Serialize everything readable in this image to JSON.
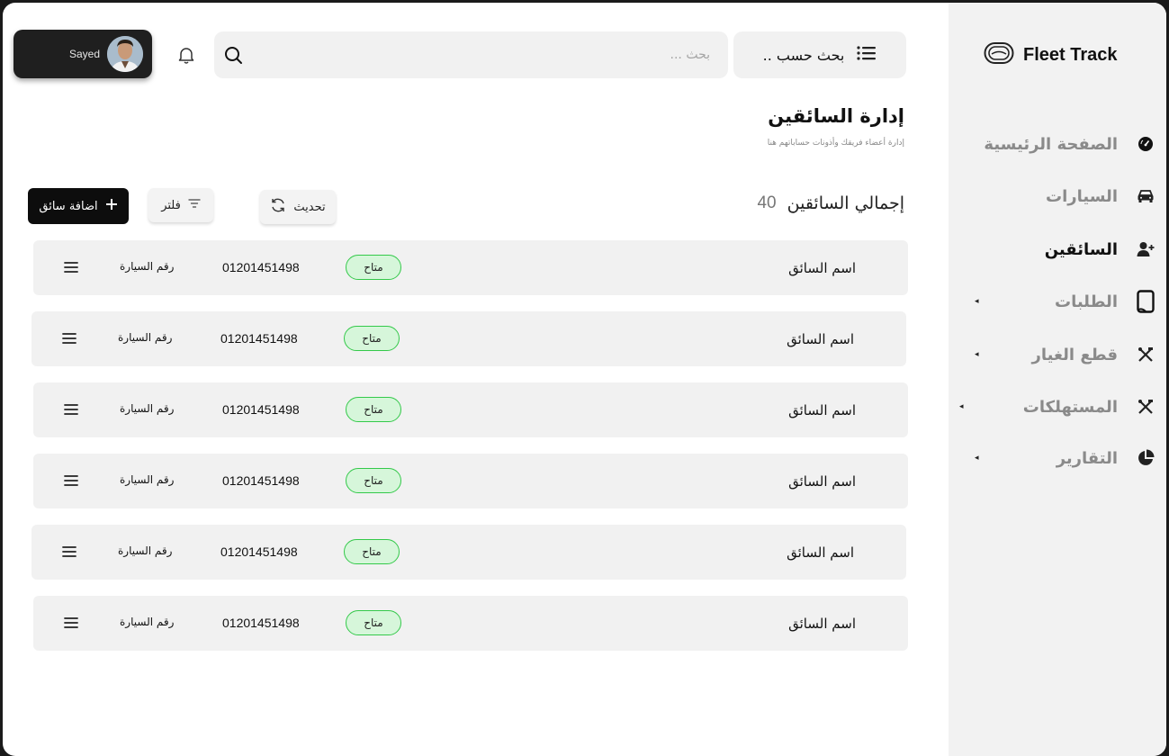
{
  "app": {
    "name": "Fleet Track"
  },
  "user": {
    "name": "Sayed"
  },
  "search": {
    "placeholder": "بحث ...",
    "by_label": "بحث حسب .."
  },
  "sidebar": {
    "items": [
      {
        "label": "الصفحة الرئيسية",
        "icon": "speedometer-icon",
        "active": false,
        "has_submenu": false
      },
      {
        "label": "السيارات",
        "icon": "car-icon",
        "active": false,
        "has_submenu": false
      },
      {
        "label": "السائقين",
        "icon": "user-add-icon",
        "active": true,
        "has_submenu": false
      },
      {
        "label": "الطلبات",
        "icon": "document-icon",
        "active": false,
        "has_submenu": true
      },
      {
        "label": "قطع الغيار",
        "icon": "tools-icon",
        "active": false,
        "has_submenu": true
      },
      {
        "label": "المستهلكات",
        "icon": "tools-icon",
        "active": false,
        "has_submenu": true
      },
      {
        "label": "التقارير",
        "icon": "pie-chart-icon",
        "active": false,
        "has_submenu": true
      }
    ]
  },
  "page": {
    "title": "إدارة السائقين",
    "subtitle": "إدارة أعضاء فريقك وأذونات حساباتهم هنا"
  },
  "toolbar": {
    "total_label": "إجمالي السائقين",
    "total_count": "40",
    "refresh_label": "تحديث",
    "filter_label": "فلتر",
    "add_label": "اضافة سائق"
  },
  "drivers": [
    {
      "name": "اسم السائق",
      "status": "متاح",
      "phone": "01201451498",
      "car": "رقم السيارة"
    },
    {
      "name": "اسم السائق",
      "status": "متاح",
      "phone": "01201451498",
      "car": "رقم السيارة"
    },
    {
      "name": "اسم السائق",
      "status": "متاح",
      "phone": "01201451498",
      "car": "رقم السيارة"
    },
    {
      "name": "اسم السائق",
      "status": "متاح",
      "phone": "01201451498",
      "car": "رقم السيارة"
    },
    {
      "name": "اسم السائق",
      "status": "متاح",
      "phone": "01201451498",
      "car": "رقم السيارة"
    },
    {
      "name": "اسم السائق",
      "status": "متاح",
      "phone": "01201451498",
      "car": "رقم السيارة"
    }
  ],
  "colors": {
    "accent": "#0d0d0d",
    "status_available": "#34c94a",
    "sidebar_bg": "#f2f2f2"
  }
}
